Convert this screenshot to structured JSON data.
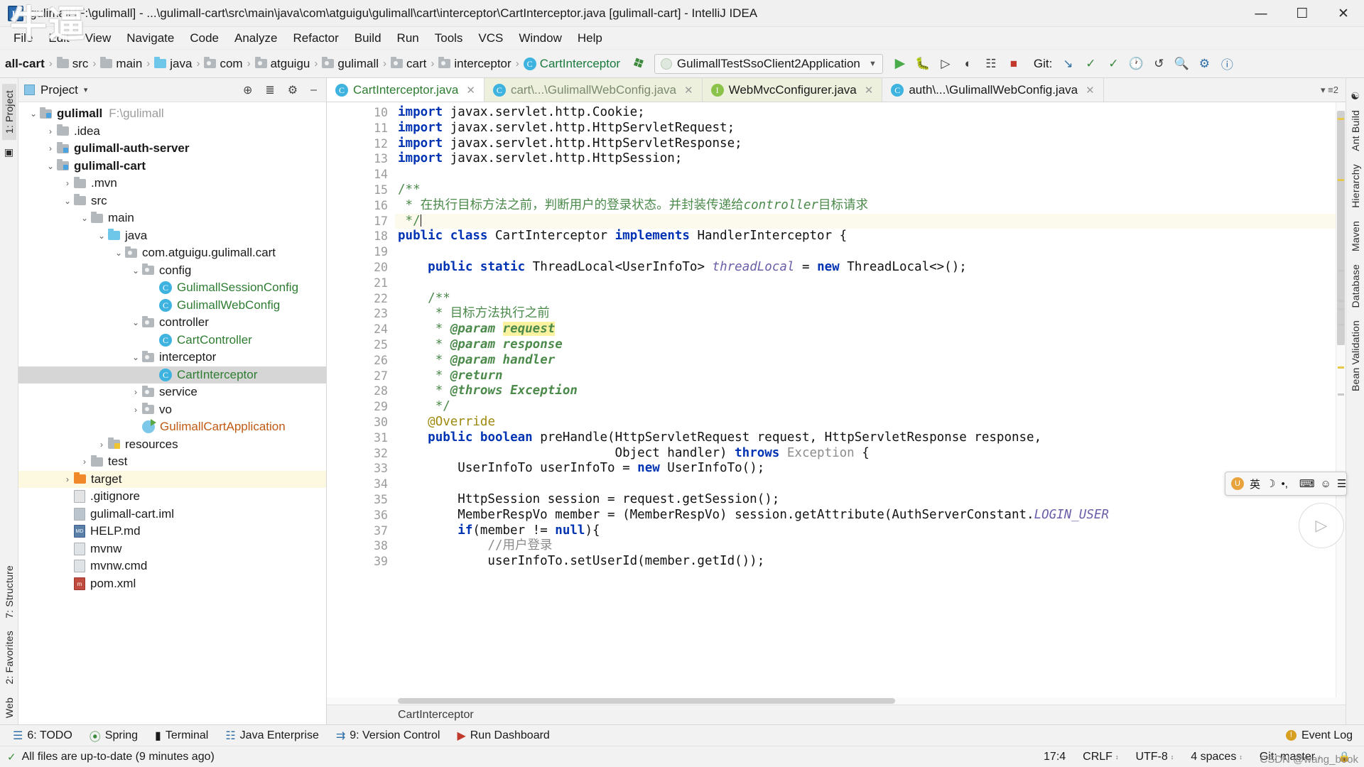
{
  "watermark": {
    "text": "牛逼",
    "credit": "CSDN @wang_book"
  },
  "titlebar": {
    "title": "gulimall [F:\\gulimall] - ...\\gulimall-cart\\src\\main\\java\\com\\atguigu\\gulimall\\cart\\interceptor\\CartInterceptor.java [gulimall-cart] - IntelliJ IDEA",
    "app_icon": "IJ",
    "minimize": "—",
    "maximize": "☐",
    "close": "✕"
  },
  "menubar": {
    "items": [
      "File",
      "Edit",
      "View",
      "Navigate",
      "Code",
      "Analyze",
      "Refactor",
      "Build",
      "Run",
      "Tools",
      "VCS",
      "Window",
      "Help"
    ]
  },
  "navbar": {
    "crumbs": [
      {
        "label": "all-cart",
        "icon": "none",
        "bold": true
      },
      {
        "label": "src",
        "icon": "folder"
      },
      {
        "label": "main",
        "icon": "folder"
      },
      {
        "label": "java",
        "icon": "folder-blue"
      },
      {
        "label": "com",
        "icon": "folder-pkg"
      },
      {
        "label": "atguigu",
        "icon": "folder-pkg"
      },
      {
        "label": "gulimall",
        "icon": "folder-pkg"
      },
      {
        "label": "cart",
        "icon": "folder-pkg"
      },
      {
        "label": "interceptor",
        "icon": "folder-pkg"
      },
      {
        "label": "CartInterceptor",
        "icon": "class",
        "green": true
      }
    ],
    "build_icon": "hammer-icon",
    "run_config": "GulimallTestSsoClient2Application",
    "git_label": "Git:",
    "toolbar_icons": [
      "run-icon",
      "debug-icon",
      "run-with-coverage-icon",
      "profile-icon",
      "stop-icon",
      "record-icon",
      "vcs-update-icon",
      "vcs-commit-icon",
      "vcs-history-icon",
      "vcs-rollback-icon",
      "search-everywhere-icon",
      "settings-icon",
      "help-icon"
    ]
  },
  "left_strip": {
    "tabs": [
      "1: Project"
    ],
    "icons": [
      "structure-icon",
      "favorites-icon",
      "web-icon"
    ],
    "labels": [
      "7: Structure",
      "2: Favorites",
      "Web"
    ]
  },
  "right_strip": {
    "labels": [
      "Ant Build",
      "Hierarchy",
      "Maven",
      "Database",
      "Bean Validation"
    ]
  },
  "project_panel": {
    "title": "Project",
    "caret": "▾",
    "icons": [
      "locate-icon",
      "collapse-all-icon",
      "settings-icon",
      "hide-icon"
    ],
    "tree": [
      {
        "depth": 0,
        "arrow": "down",
        "icon": "module-folder",
        "label": "gulimall",
        "bold": true,
        "path": "F:\\gulimall"
      },
      {
        "depth": 1,
        "arrow": "right",
        "icon": "folder",
        "label": ".idea"
      },
      {
        "depth": 1,
        "arrow": "right",
        "icon": "module-folder",
        "label": "gulimall-auth-server",
        "bold": true
      },
      {
        "depth": 1,
        "arrow": "down",
        "icon": "module-folder",
        "label": "gulimall-cart",
        "bold": true
      },
      {
        "depth": 2,
        "arrow": "right",
        "icon": "folder",
        "label": ".mvn"
      },
      {
        "depth": 2,
        "arrow": "down",
        "icon": "folder",
        "label": "src"
      },
      {
        "depth": 3,
        "arrow": "down",
        "icon": "folder",
        "label": "main"
      },
      {
        "depth": 4,
        "arrow": "down",
        "icon": "folder-blue",
        "label": "java"
      },
      {
        "depth": 5,
        "arrow": "down",
        "icon": "folder-pkg",
        "label": "com.atguigu.gulimall.cart"
      },
      {
        "depth": 6,
        "arrow": "down",
        "icon": "folder-pkg",
        "label": "config"
      },
      {
        "depth": 7,
        "arrow": "none",
        "icon": "class",
        "label": "GulimallSessionConfig",
        "color": "green"
      },
      {
        "depth": 7,
        "arrow": "none",
        "icon": "class",
        "label": "GulimallWebConfig",
        "color": "green"
      },
      {
        "depth": 6,
        "arrow": "down",
        "icon": "folder-pkg",
        "label": "controller"
      },
      {
        "depth": 7,
        "arrow": "none",
        "icon": "class",
        "label": "CartController",
        "color": "green"
      },
      {
        "depth": 6,
        "arrow": "down",
        "icon": "folder-pkg",
        "label": "interceptor"
      },
      {
        "depth": 7,
        "arrow": "none",
        "icon": "class",
        "label": "CartInterceptor",
        "color": "green",
        "selected": true
      },
      {
        "depth": 6,
        "arrow": "right",
        "icon": "folder-pkg",
        "label": "service"
      },
      {
        "depth": 6,
        "arrow": "right",
        "icon": "folder-pkg",
        "label": "vo"
      },
      {
        "depth": 6,
        "arrow": "none",
        "icon": "spring-class",
        "label": "GulimallCartApplication",
        "color": "orange"
      },
      {
        "depth": 4,
        "arrow": "right",
        "icon": "folder-res",
        "label": "resources"
      },
      {
        "depth": 3,
        "arrow": "right",
        "icon": "folder",
        "label": "test"
      },
      {
        "depth": 2,
        "arrow": "right",
        "icon": "folder-orange",
        "label": "target",
        "highlight": true
      },
      {
        "depth": 2,
        "arrow": "none",
        "icon": "file-git",
        "label": ".gitignore"
      },
      {
        "depth": 2,
        "arrow": "none",
        "icon": "file-iml",
        "label": "gulimall-cart.iml"
      },
      {
        "depth": 2,
        "arrow": "none",
        "icon": "file-md",
        "label": "HELP.md"
      },
      {
        "depth": 2,
        "arrow": "none",
        "icon": "file",
        "label": "mvnw"
      },
      {
        "depth": 2,
        "arrow": "none",
        "icon": "file",
        "label": "mvnw.cmd"
      },
      {
        "depth": 2,
        "arrow": "none",
        "icon": "file-mvn",
        "label": "pom.xml"
      }
    ]
  },
  "editor": {
    "tabs": [
      {
        "label": "CartInterceptor.java",
        "icon": "class",
        "active": true,
        "color": "green",
        "close": "✕"
      },
      {
        "label": "cart\\...\\GulimallWebConfig.java",
        "icon": "class",
        "tinted": true,
        "color": "gray",
        "close": "✕"
      },
      {
        "label": "WebMvcConfigurer.java",
        "icon": "interface",
        "tinted": true,
        "close": "✕"
      },
      {
        "label": "auth\\...\\GulimallWebConfig.java",
        "icon": "class",
        "close": "✕"
      }
    ],
    "tabs_right": "▾ ≡2",
    "first_line_number": 10,
    "lines": [
      {
        "n": 10,
        "html": "<span class='kw'>import</span> javax.servlet.http.Cookie;"
      },
      {
        "n": 11,
        "html": "<span class='kw'>import</span> javax.servlet.http.HttpServletRequest;"
      },
      {
        "n": 12,
        "html": "<span class='kw'>import</span> javax.servlet.http.HttpServletResponse;"
      },
      {
        "n": 13,
        "html": "<span class='kw'>import</span> javax.servlet.http.HttpSession;"
      },
      {
        "n": 14,
        "html": ""
      },
      {
        "n": 15,
        "html": "<span class='doc'>/**</span>",
        "fold": "-"
      },
      {
        "n": 16,
        "html": "<span class='doc'> * 在执行目标方法之前，判断用户的登录状态。并封装传递给<i>controller</i>目标请求</span>"
      },
      {
        "n": 17,
        "html": "<span class='doc'> */</span><span class='caret-bar'></span>",
        "caret": true
      },
      {
        "n": 18,
        "html": "<span class='kw'>public</span> <span class='kw'>class</span> CartInterceptor <span class='kw'>implements</span> HandlerInterceptor {"
      },
      {
        "n": 19,
        "html": ""
      },
      {
        "n": 20,
        "html": "    <span class='kw'>public</span> <span class='kw'>static</span> ThreadLocal&lt;UserInfoTo&gt; <span class='static-f'>threadLocal</span> = <span class='kw'>new</span> ThreadLocal&lt;&gt;();"
      },
      {
        "n": 21,
        "html": ""
      },
      {
        "n": 22,
        "html": "    <span class='doc'>/**</span>",
        "fold": "-"
      },
      {
        "n": 23,
        "html": "    <span class='doc'> * 目标方法执行之前</span>"
      },
      {
        "n": 24,
        "html": "    <span class='doc'> * </span><span class='doctag'>@param</span> <span class='hlyellow doctag'>request</span>"
      },
      {
        "n": 25,
        "html": "    <span class='doc'> * </span><span class='doctag'>@param</span> <span class='doctag'>response</span>"
      },
      {
        "n": 26,
        "html": "    <span class='doc'> * </span><span class='doctag'>@param</span> <span class='doctag'>handler</span>"
      },
      {
        "n": 27,
        "html": "    <span class='doc'> * </span><span class='doctag'>@return</span>"
      },
      {
        "n": 28,
        "html": "    <span class='doc'> * </span><span class='doctag'>@throws</span> <span class='doctag'>Exception</span>"
      },
      {
        "n": 29,
        "html": "    <span class='doc'> */</span>",
        "fold": "-"
      },
      {
        "n": 30,
        "html": "    <span class='ann'>@Override</span>"
      },
      {
        "n": 31,
        "html": "    <span class='kw'>public</span> <span class='kw'>boolean</span> preHandle(HttpServletRequest request, HttpServletResponse response,",
        "runmark": true,
        "atmark": true
      },
      {
        "n": 32,
        "html": "                             Object handler) <span class='kw'>throws</span> <span class='gray'>Exception</span> {",
        "fold": "-"
      },
      {
        "n": 33,
        "html": "        UserInfoTo userInfoTo = <span class='kw'>new</span> UserInfoTo();"
      },
      {
        "n": 34,
        "html": ""
      },
      {
        "n": 35,
        "html": "        HttpSession session = request.getSession();"
      },
      {
        "n": 36,
        "html": "        MemberRespVo member = (MemberRespVo) session.getAttribute(AuthServerConstant.<span class='static-f'>LOGIN_USER</span>"
      },
      {
        "n": 37,
        "html": "        <span class='kw'>if</span>(member != <span class='kw'>null</span>){",
        "fold": "-"
      },
      {
        "n": 38,
        "html": "            <span class='cmt'>//用户登录</span>"
      },
      {
        "n": 39,
        "html": "            userInfoTo.setUserId(member.getId());"
      }
    ],
    "status_breadcrumb": "CartInterceptor"
  },
  "bottom_tools": {
    "items": [
      {
        "label": "6: TODO",
        "icon": "todo-icon"
      },
      {
        "label": "Spring",
        "icon": "spring-icon"
      },
      {
        "label": "Terminal",
        "icon": "terminal-icon"
      },
      {
        "label": "Java Enterprise",
        "icon": "java-enterprise-icon"
      },
      {
        "label": "9: Version Control",
        "icon": "version-control-icon"
      },
      {
        "label": "Run Dashboard",
        "icon": "run-dashboard-icon"
      }
    ],
    "event_log": "Event Log"
  },
  "statusbar": {
    "message": "All files are up-to-date (9 minutes ago)",
    "caret_position": "17:4",
    "line_separator": "CRLF",
    "encoding": "UTF-8",
    "indent": "4 spaces",
    "git_branch": "Git: master",
    "lock_icon": "lock-icon"
  },
  "ime": {
    "logo": "U",
    "lang": "英",
    "items": [
      "☽",
      "•,",
      "⌨",
      "☺",
      "☰"
    ]
  }
}
